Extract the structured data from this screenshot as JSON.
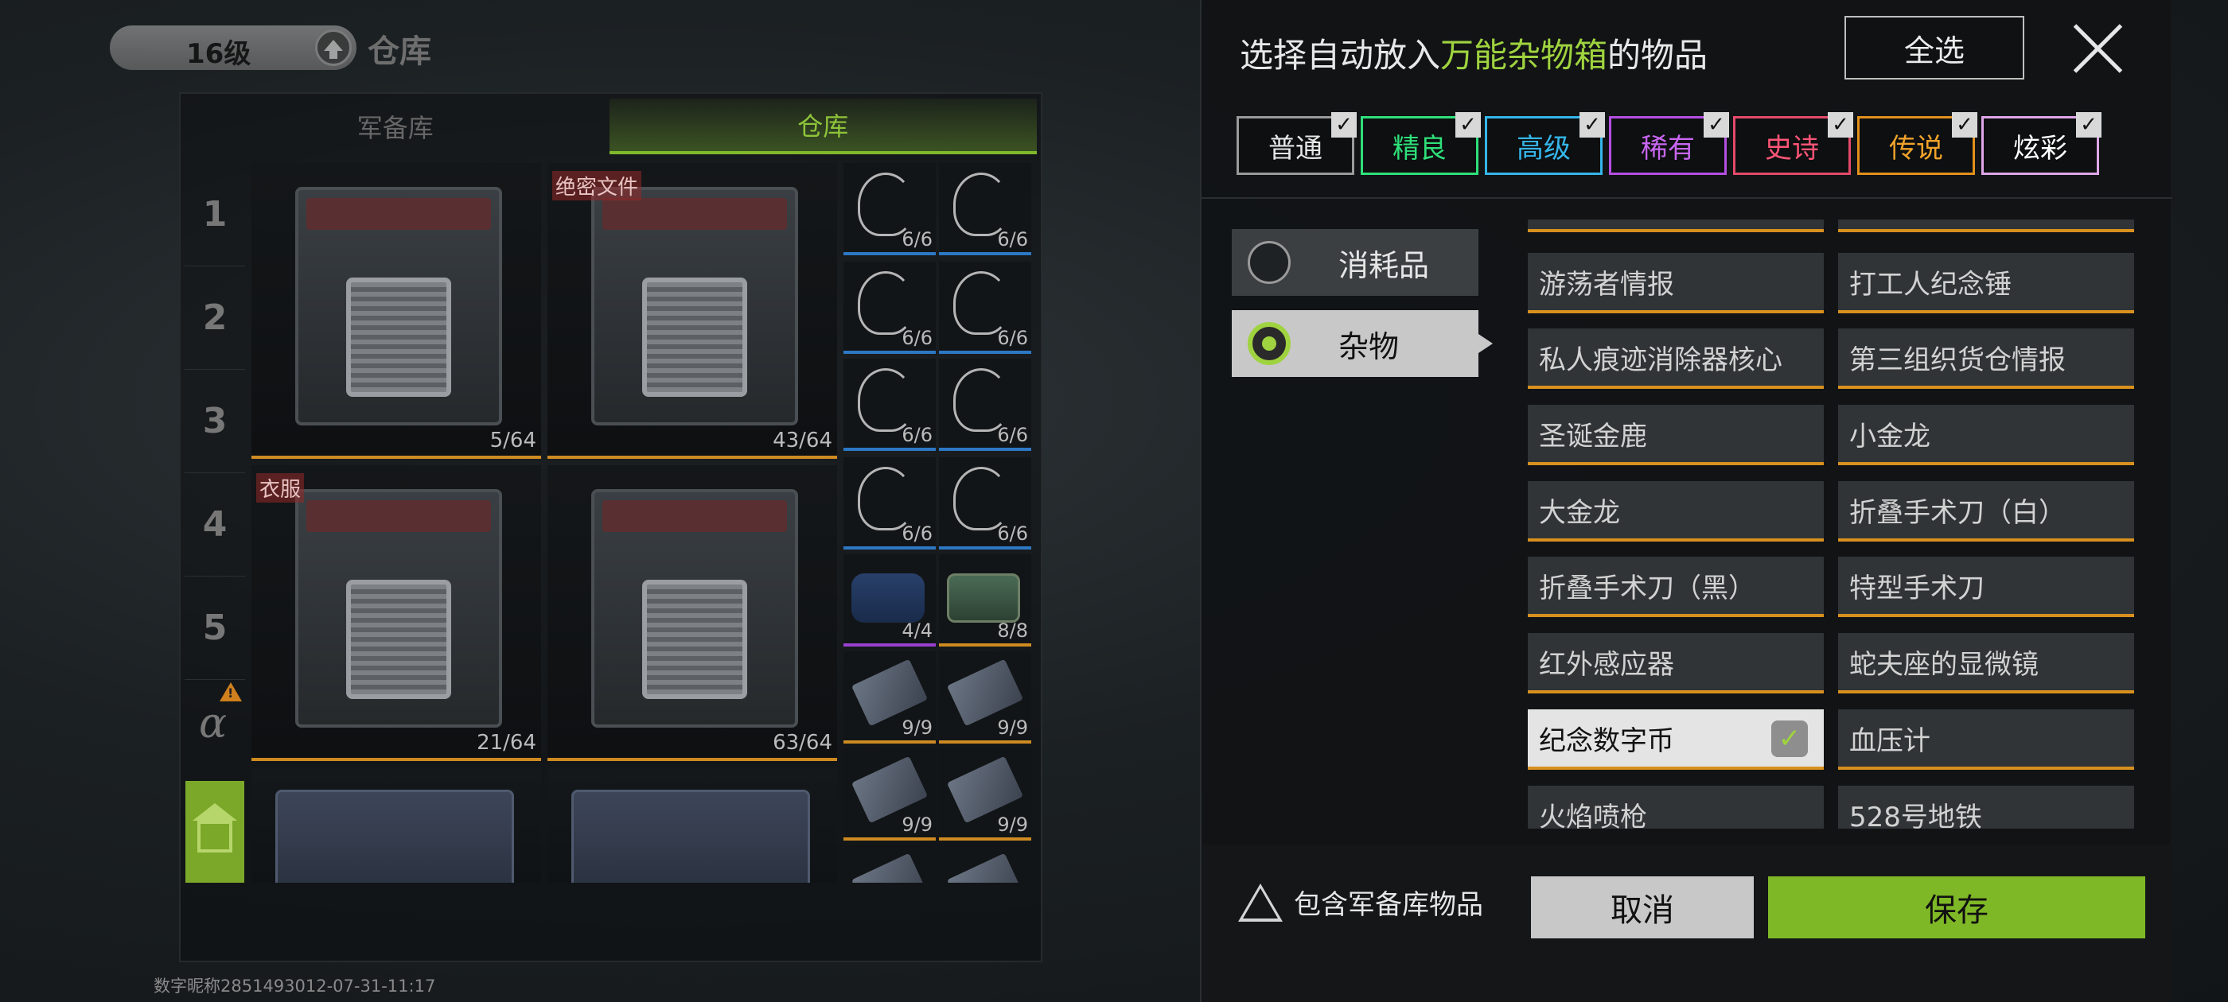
{
  "left": {
    "level": "16级",
    "title": "仓库",
    "tabs": [
      "军备库",
      "仓库"
    ],
    "rows": [
      "1",
      "2",
      "3",
      "4",
      "5"
    ],
    "alpha": "α",
    "crates": [
      {
        "tag": "",
        "count": "5/64"
      },
      {
        "tag": "绝密文件",
        "count": "43/64"
      },
      {
        "tag": "衣服",
        "count": "21/64"
      },
      {
        "tag": "",
        "count": "63/64"
      }
    ],
    "small_counts": [
      "6/6",
      "6/6",
      "6/6",
      "6/6",
      "6/6",
      "6/6",
      "6/6",
      "6/6",
      "4/4",
      "8/8",
      "9/9",
      "9/9",
      "9/9",
      "9/9"
    ],
    "footer": "数字昵称2851493012-07-31-11:17"
  },
  "dialog": {
    "title_pre": "选择自动放入",
    "title_hl": "万能杂物箱",
    "title_post": "的物品",
    "select_all": "全选",
    "rarities": [
      {
        "label": "普通",
        "color": "#9a9a9a",
        "text": "#e6e6e6"
      },
      {
        "label": "精良",
        "color": "#2ee07a",
        "text": "#2ee07a"
      },
      {
        "label": "高级",
        "color": "#35b6ea",
        "text": "#35b6ea"
      },
      {
        "label": "稀有",
        "color": "#b54fe3",
        "text": "#c866f0"
      },
      {
        "label": "史诗",
        "color": "#e44a6a",
        "text": "#ff5577"
      },
      {
        "label": "传说",
        "color": "#e2901c",
        "text": "#f0a22a"
      },
      {
        "label": "炫彩",
        "color": "#dfa6e8",
        "text": "#ffffff"
      }
    ],
    "categories": [
      "消耗品",
      "杂物"
    ],
    "items": [
      [
        "游荡者情报",
        "打工人纪念锤"
      ],
      [
        "私人痕迹消除器核心",
        "第三组织货仓情报"
      ],
      [
        "圣诞金鹿",
        "小金龙"
      ],
      [
        "大金龙",
        "折叠手术刀（白）"
      ],
      [
        "折叠手术刀（黑）",
        "特型手术刀"
      ],
      [
        "红外感应器",
        "蛇夫座的显微镜"
      ],
      [
        "纪念数字币",
        "血压计"
      ],
      [
        "火焰喷枪",
        "528号地铁"
      ]
    ],
    "include_armory": "包含军备库物品",
    "cancel": "取消",
    "save": "保存"
  }
}
